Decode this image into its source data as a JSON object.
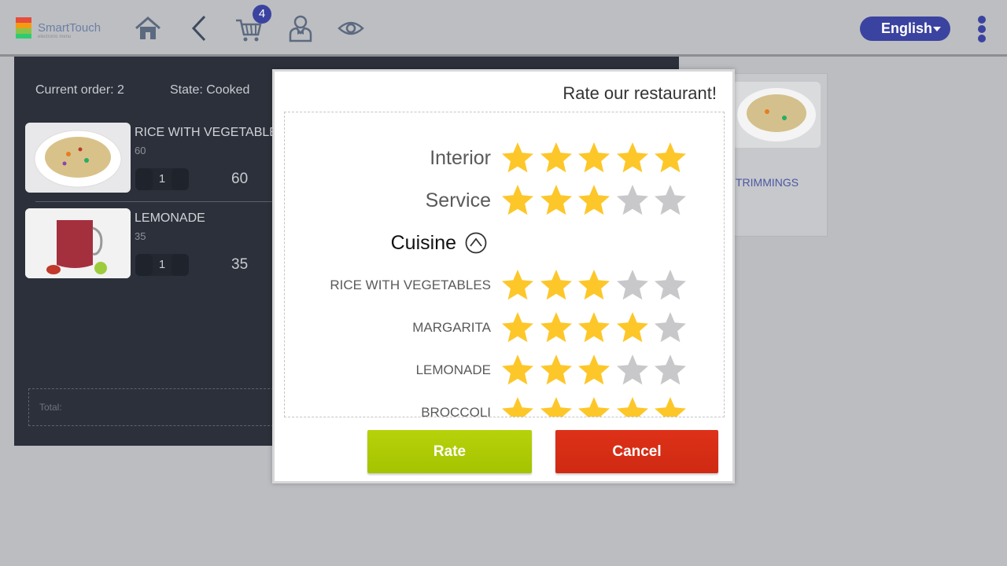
{
  "app": {
    "logo_title": "SmartTouch",
    "logo_subtitle": "electronic menu"
  },
  "topbar": {
    "icons": [
      "home-icon",
      "back-icon",
      "cart-icon",
      "waiter-icon",
      "eye-icon"
    ],
    "cart_count": "4",
    "language": "English"
  },
  "order": {
    "current_label": "Current order: 2",
    "state_label": "State: Cooked",
    "items": [
      {
        "name": "RICE WITH VEGETABLES",
        "price": "60",
        "qty": "1",
        "total": "60"
      },
      {
        "name": "LEMONADE",
        "price": "35",
        "qty": "1",
        "total": "35"
      }
    ],
    "total_label": "Total:"
  },
  "menu_card": {
    "name": "TRIMMINGS"
  },
  "dialog": {
    "title": "Rate our restaurant!",
    "categories": [
      {
        "label": "Interior",
        "rating": 5
      },
      {
        "label": "Service",
        "rating": 3
      }
    ],
    "cuisine_label": "Cuisine",
    "dishes": [
      {
        "label": "RICE WITH VEGETABLES",
        "rating": 3
      },
      {
        "label": "MARGARITA",
        "rating": 4
      },
      {
        "label": "LEMONADE",
        "rating": 3
      },
      {
        "label": "BROCCOLI",
        "rating": 5
      }
    ],
    "max_rating": 5,
    "rate_label": "Rate",
    "cancel_label": "Cancel"
  },
  "colors": {
    "accent": "#3b43a0",
    "star_on": "#fdc72a",
    "star_off": "#c8c8ca",
    "rate_button": "#adc900",
    "cancel_button": "#d62e16"
  }
}
